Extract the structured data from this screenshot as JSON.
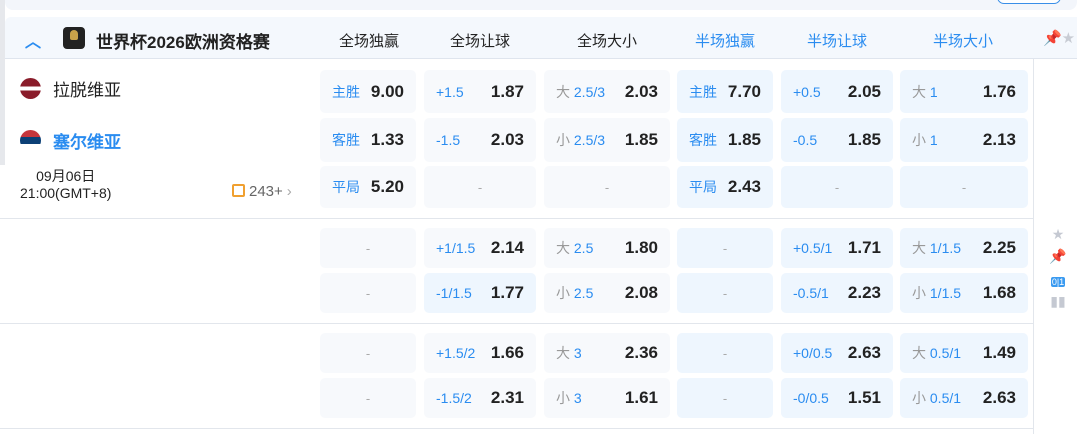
{
  "league": {
    "name": "世界杯2026欧洲资格赛",
    "columns": [
      "全场独赢",
      "全场让球",
      "全场大小",
      "半场独赢",
      "半场让球",
      "半场大小"
    ]
  },
  "match": {
    "home": "拉脱维亚",
    "away": "塞尔维亚",
    "date": "09月06日",
    "time": "21:00(GMT+8)",
    "more_count": "243+"
  },
  "groups": [
    [
      [
        {
          "l": "主胜",
          "v": "9.00"
        },
        {
          "l": "+1.5",
          "v": "1.87"
        },
        {
          "p": "大",
          "l": "2.5/3",
          "v": "2.03"
        },
        {
          "l": "主胜",
          "v": "7.70"
        },
        {
          "l": "+0.5",
          "v": "2.05"
        },
        {
          "p": "大",
          "l": "1",
          "v": "1.76"
        }
      ],
      [
        {
          "l": "客胜",
          "v": "1.33"
        },
        {
          "l": "-1.5",
          "v": "2.03"
        },
        {
          "p": "小",
          "l": "2.5/3",
          "v": "1.85"
        },
        {
          "l": "客胜",
          "v": "1.85"
        },
        {
          "l": "-0.5",
          "v": "1.85"
        },
        {
          "p": "小",
          "l": "1",
          "v": "2.13"
        }
      ],
      [
        {
          "l": "平局",
          "v": "5.20"
        },
        {
          "d": "-"
        },
        {
          "d": "-"
        },
        {
          "l": "平局",
          "v": "2.43"
        },
        {
          "d": "-"
        },
        {
          "d": "-"
        }
      ]
    ],
    [
      [
        {
          "d": "-"
        },
        {
          "l": "+1/1.5",
          "v": "2.14"
        },
        {
          "p": "大",
          "l": "2.5",
          "v": "1.80"
        },
        {
          "d": "-"
        },
        {
          "l": "+0.5/1",
          "v": "1.71"
        },
        {
          "p": "大",
          "l": "1/1.5",
          "v": "2.25"
        }
      ],
      [
        {
          "d": "-"
        },
        {
          "l": "-1/1.5",
          "v": "1.77"
        },
        {
          "p": "小",
          "l": "2.5",
          "v": "2.08"
        },
        {
          "d": "-"
        },
        {
          "l": "-0.5/1",
          "v": "2.23"
        },
        {
          "p": "小",
          "l": "1/1.5",
          "v": "1.68"
        }
      ]
    ],
    [
      [
        {
          "d": "-"
        },
        {
          "l": "+1.5/2",
          "v": "1.66"
        },
        {
          "p": "大",
          "l": "3",
          "v": "2.36"
        },
        {
          "d": "-"
        },
        {
          "l": "+0/0.5",
          "v": "2.63"
        },
        {
          "p": "大",
          "l": "0.5/1",
          "v": "1.49"
        }
      ],
      [
        {
          "d": "-"
        },
        {
          "l": "-1.5/2",
          "v": "2.31"
        },
        {
          "p": "小",
          "l": "3",
          "v": "1.61"
        },
        {
          "d": "-"
        },
        {
          "l": "-0/0.5",
          "v": "1.51"
        },
        {
          "p": "小",
          "l": "0.5/1",
          "v": "2.63"
        }
      ]
    ]
  ],
  "side_icons": [
    "star-icon",
    "pin-icon",
    "score-icon",
    "stats-icon"
  ],
  "score_badge": "0|1"
}
